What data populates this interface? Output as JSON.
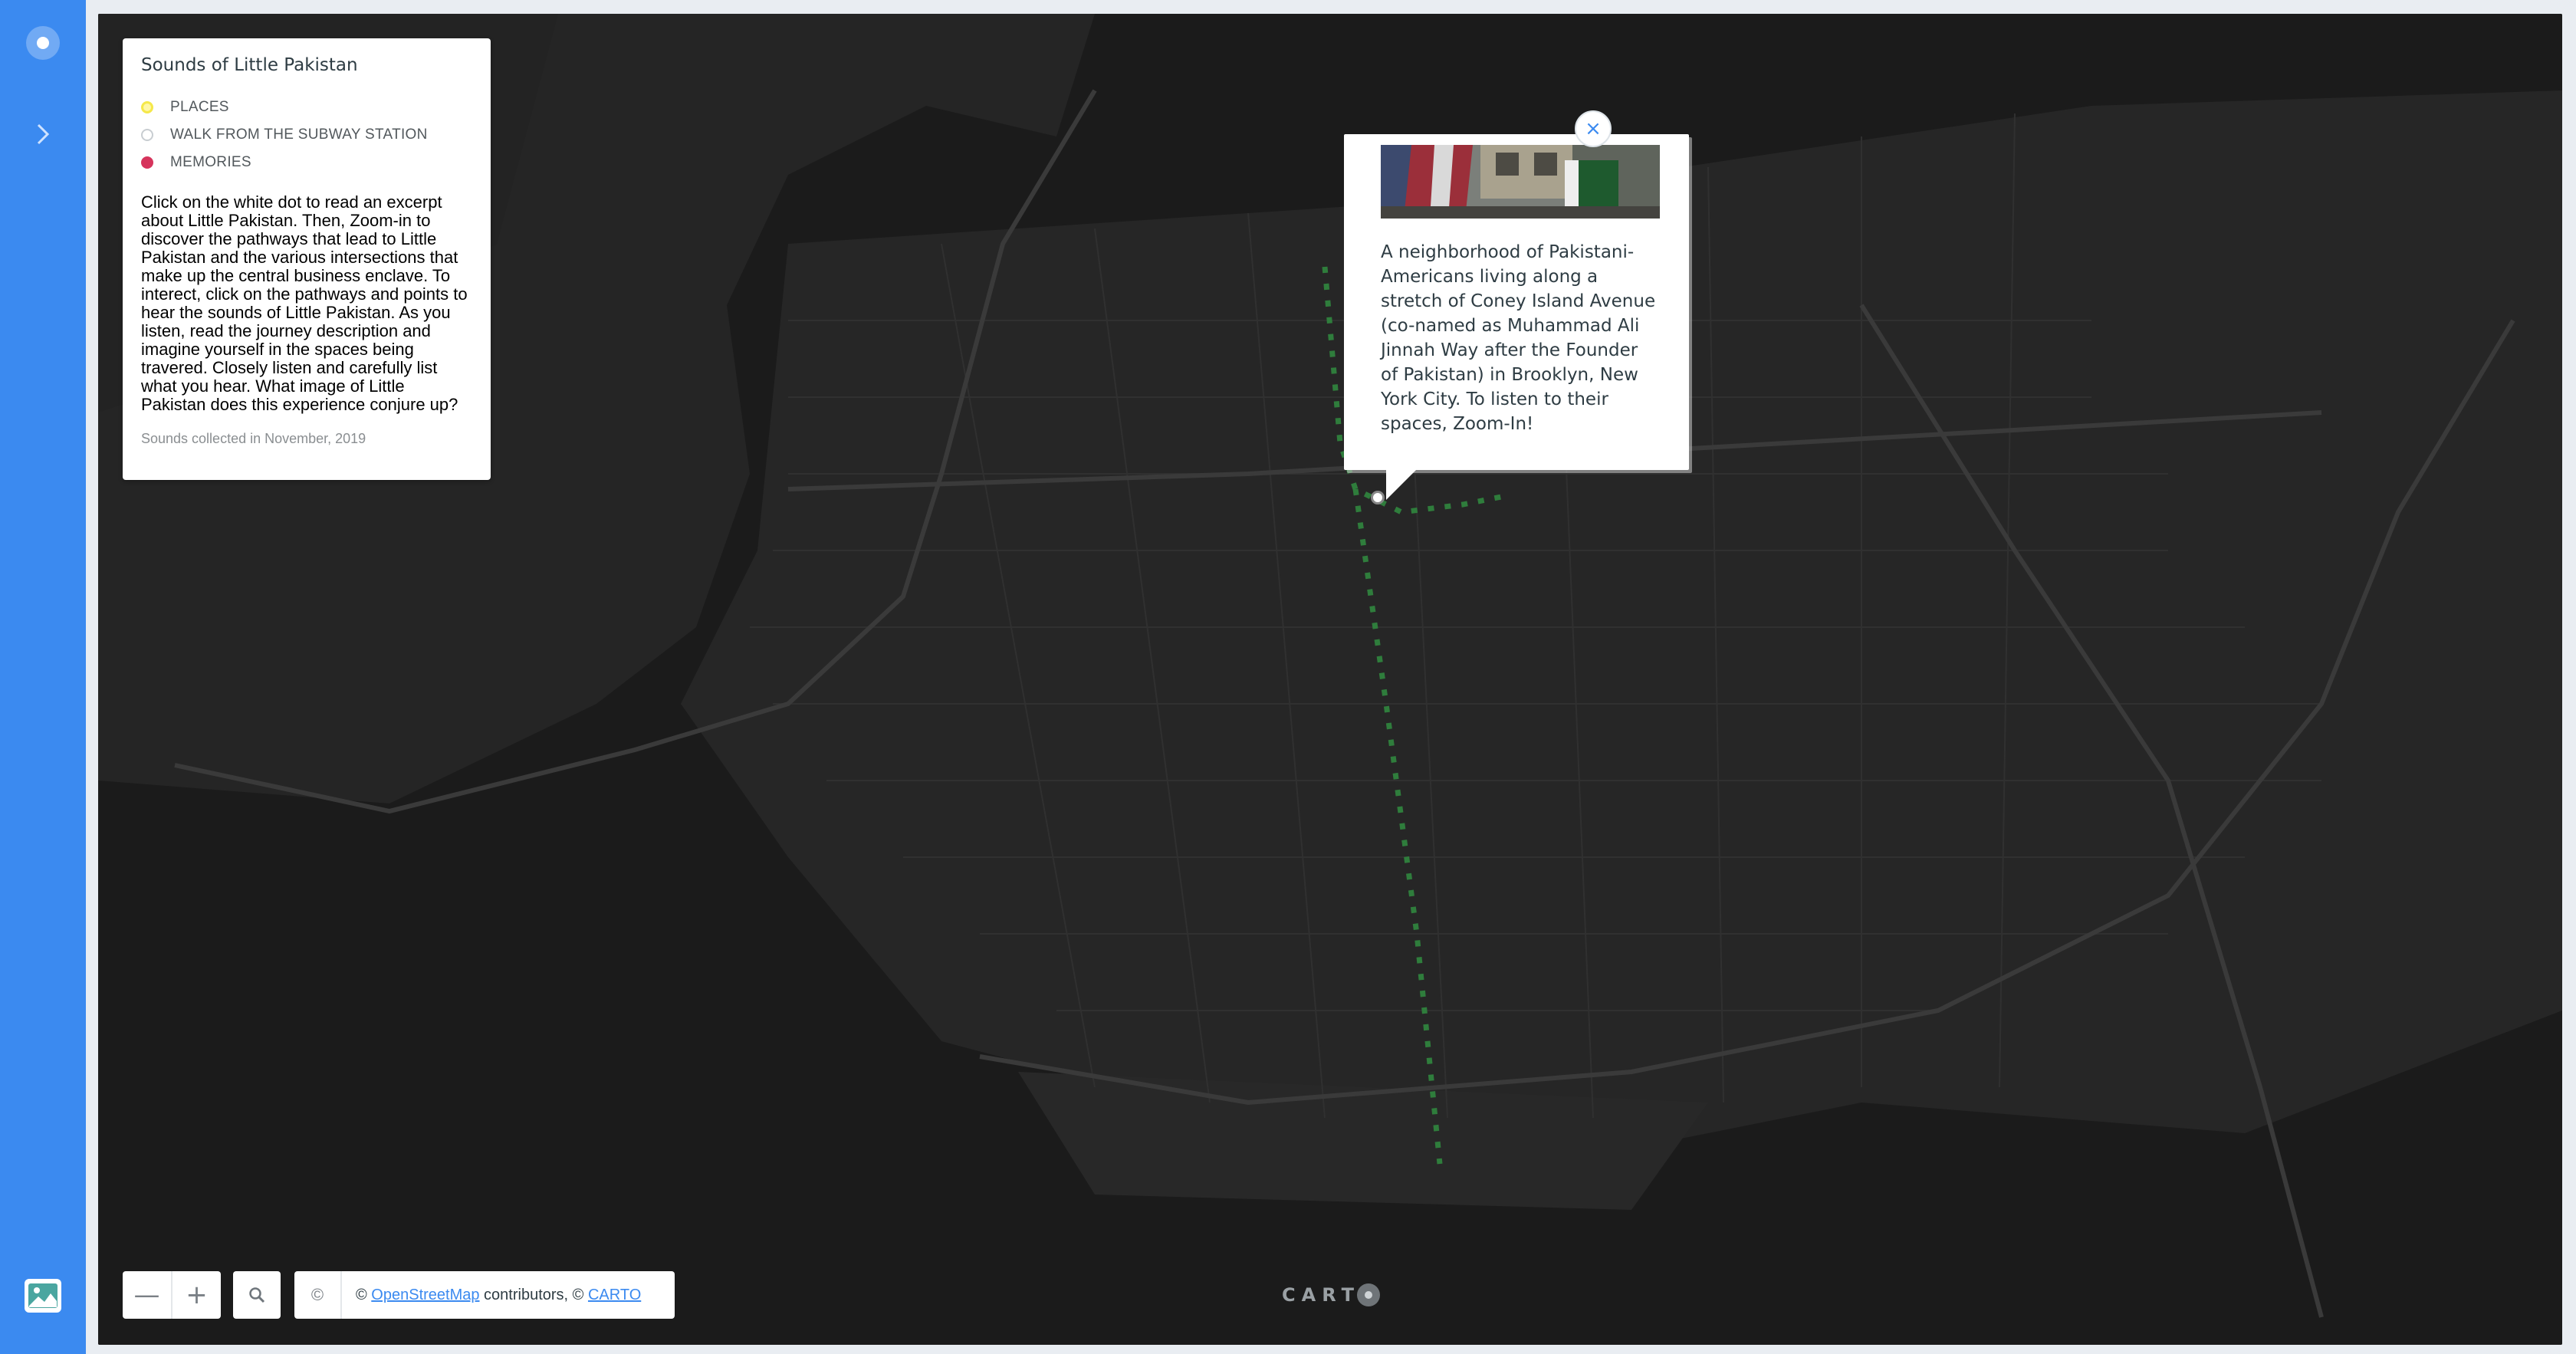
{
  "legend": {
    "title": "Sounds of Little Pakistan",
    "items": [
      {
        "label": "PLACES",
        "color": "#f5e84a",
        "style": "filled-soft"
      },
      {
        "label": "WALK FROM THE SUBWAY STATION",
        "color": "#ffffff",
        "style": "outline"
      },
      {
        "label": "MEMORIES",
        "color": "#d6345c",
        "style": "filled"
      }
    ],
    "description": "Click on the white dot to read an excerpt about Little Pakistan. Then, Zoom-in to discover the pathways that lead to Little Pakistan and the various intersections that make up the central business enclave. To interect, click on the pathways and points to hear the sounds of Little Pakistan. As you listen, read the journey description and imagine yourself in the spaces being travered. Closely listen and carefully list what you hear. What image of Little Pakistan does this experience conjure up?",
    "footer": "Sounds collected in November, 2019"
  },
  "popup": {
    "text": "A neighborhood of Pakistani-Americans living along a stretch of Coney Island Avenue (co-named as Muhammad Ali Jinnah Way after the Founder of Pakistan) in Brooklyn, New York City. To listen to their spaces, Zoom-In!",
    "close_label": "×"
  },
  "controls": {
    "zoom_out_label": "—",
    "zoom_in_label": "+",
    "attribution_toggle": "©",
    "attribution_prefix": "© ",
    "attribution_osm": "OpenStreetMap",
    "attribution_mid": " contributors, © ",
    "attribution_carto": "CARTO"
  },
  "brand": {
    "logo_text": "CART",
    "accent": "#3b8af0",
    "map_bg": "#1d1d1d",
    "route_color": "#2f7d3c"
  }
}
